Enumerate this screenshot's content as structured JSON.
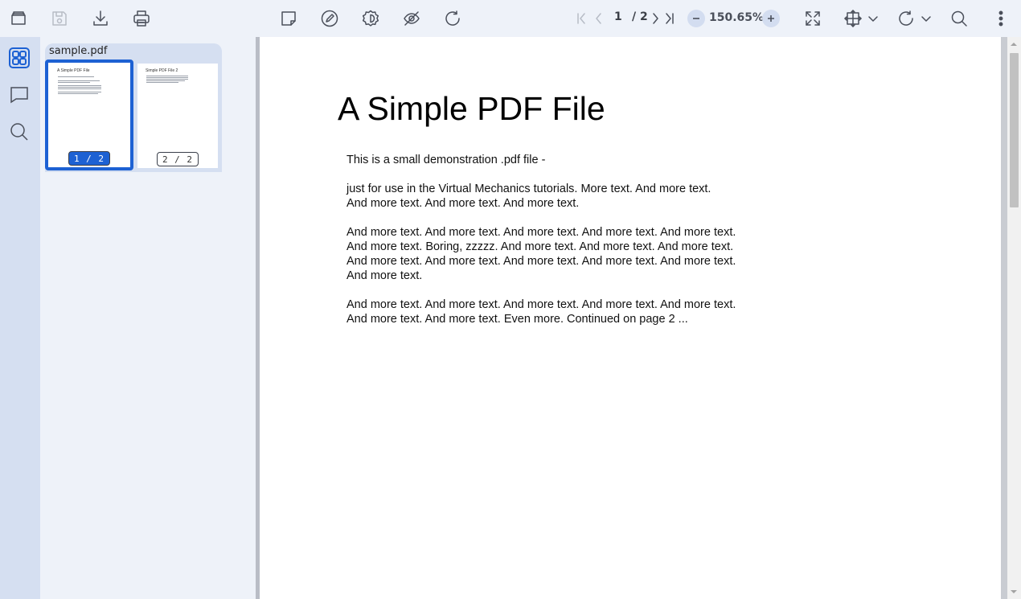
{
  "toolbar": {
    "left_icons": [
      "open-file-icon",
      "save-icon",
      "download-icon",
      "print-icon"
    ],
    "center_icons": [
      "sticky-note-icon",
      "pen-icon",
      "settings-gear-icon",
      "hide-eye-icon",
      "refresh-icon"
    ],
    "page_current": "1",
    "page_total": "/ 2",
    "zoom": "150.65%",
    "right_icons": [
      "fullscreen-icon",
      "fit-page-icon",
      "rotate-icon",
      "search-icon",
      "more-options-icon"
    ]
  },
  "left_rail": {
    "items": [
      "thumbnails-icon",
      "comments-icon",
      "search-icon"
    ],
    "active": "thumbnails-icon"
  },
  "thumbnails": {
    "file_name": "sample.pdf",
    "pages": [
      {
        "label": "1 / 2",
        "title": "A Simple PDF File",
        "selected": true
      },
      {
        "label": "2 / 2",
        "title": "Simple PDF File 2",
        "selected": false
      }
    ]
  },
  "document": {
    "title": "A Simple PDF File",
    "paragraphs": [
      "This is a small demonstration .pdf file -",
      "just for use in the Virtual Mechanics tutorials. More text. And more text. And more text. And more text. And more text.",
      "And more text. And more text. And more text. And more text. And more text. And more text. Boring, zzzzz. And more text. And more text. And more text. And more text. And more text. And more text. And more text. And more text. And more text.",
      "And more text. And more text. And more text. And more text. And more text. And more text. And more text. Even more. Continued on page 2 ..."
    ]
  },
  "colors": {
    "accent": "#1d61d3",
    "toolbar_bg": "#eef2f9",
    "rail_bg": "#d5dff1",
    "icon": "#4a4f5a"
  }
}
